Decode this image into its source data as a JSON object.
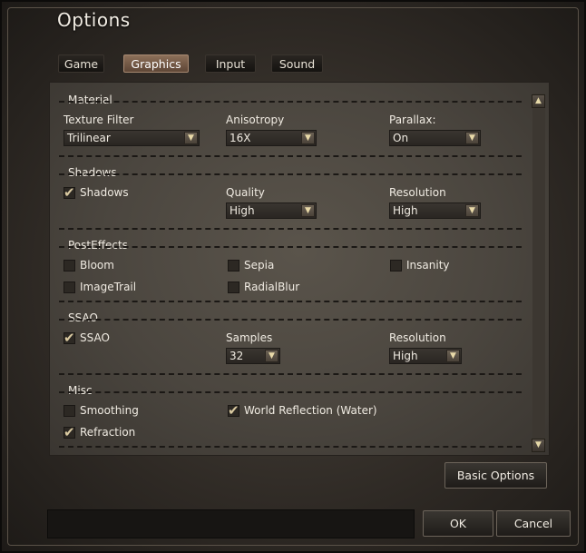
{
  "window": {
    "title": "Options"
  },
  "tabs": [
    {
      "label": "Game"
    },
    {
      "label": "Graphics"
    },
    {
      "label": "Input"
    },
    {
      "label": "Sound"
    }
  ],
  "material": {
    "title": "Material",
    "texture_filter_label": "Texture Filter",
    "texture_filter_value": "Trilinear",
    "anisotropy_label": "Anisotropy",
    "anisotropy_value": "16X",
    "parallax_label": "Parallax:",
    "parallax_value": "On"
  },
  "shadows": {
    "title": "Shadows",
    "shadows_label": "Shadows",
    "shadows_checked": true,
    "quality_label": "Quality",
    "quality_value": "High",
    "resolution_label": "Resolution",
    "resolution_value": "High"
  },
  "posteffects": {
    "title": "PostEffects",
    "bloom_label": "Bloom",
    "sepia_label": "Sepia",
    "insanity_label": "Insanity",
    "imagetrail_label": "ImageTrail",
    "radialblur_label": "RadialBlur"
  },
  "ssao": {
    "title": "SSAO",
    "ssao_label": "SSAO",
    "ssao_checked": true,
    "samples_label": "Samples",
    "samples_value": "32",
    "resolution_label": "Resolution",
    "resolution_value": "High"
  },
  "misc": {
    "title": "Misc",
    "smoothing_label": "Smoothing",
    "world_reflection_label": "World Reflection (Water)",
    "refraction_label": "Refraction"
  },
  "buttons": {
    "basic_options": "Basic Options",
    "ok": "OK",
    "cancel": "Cancel"
  },
  "icons": {
    "checkmark": "✔",
    "dropdown_arrow": "▼",
    "scroll_up": "▲",
    "scroll_down": "▼"
  }
}
